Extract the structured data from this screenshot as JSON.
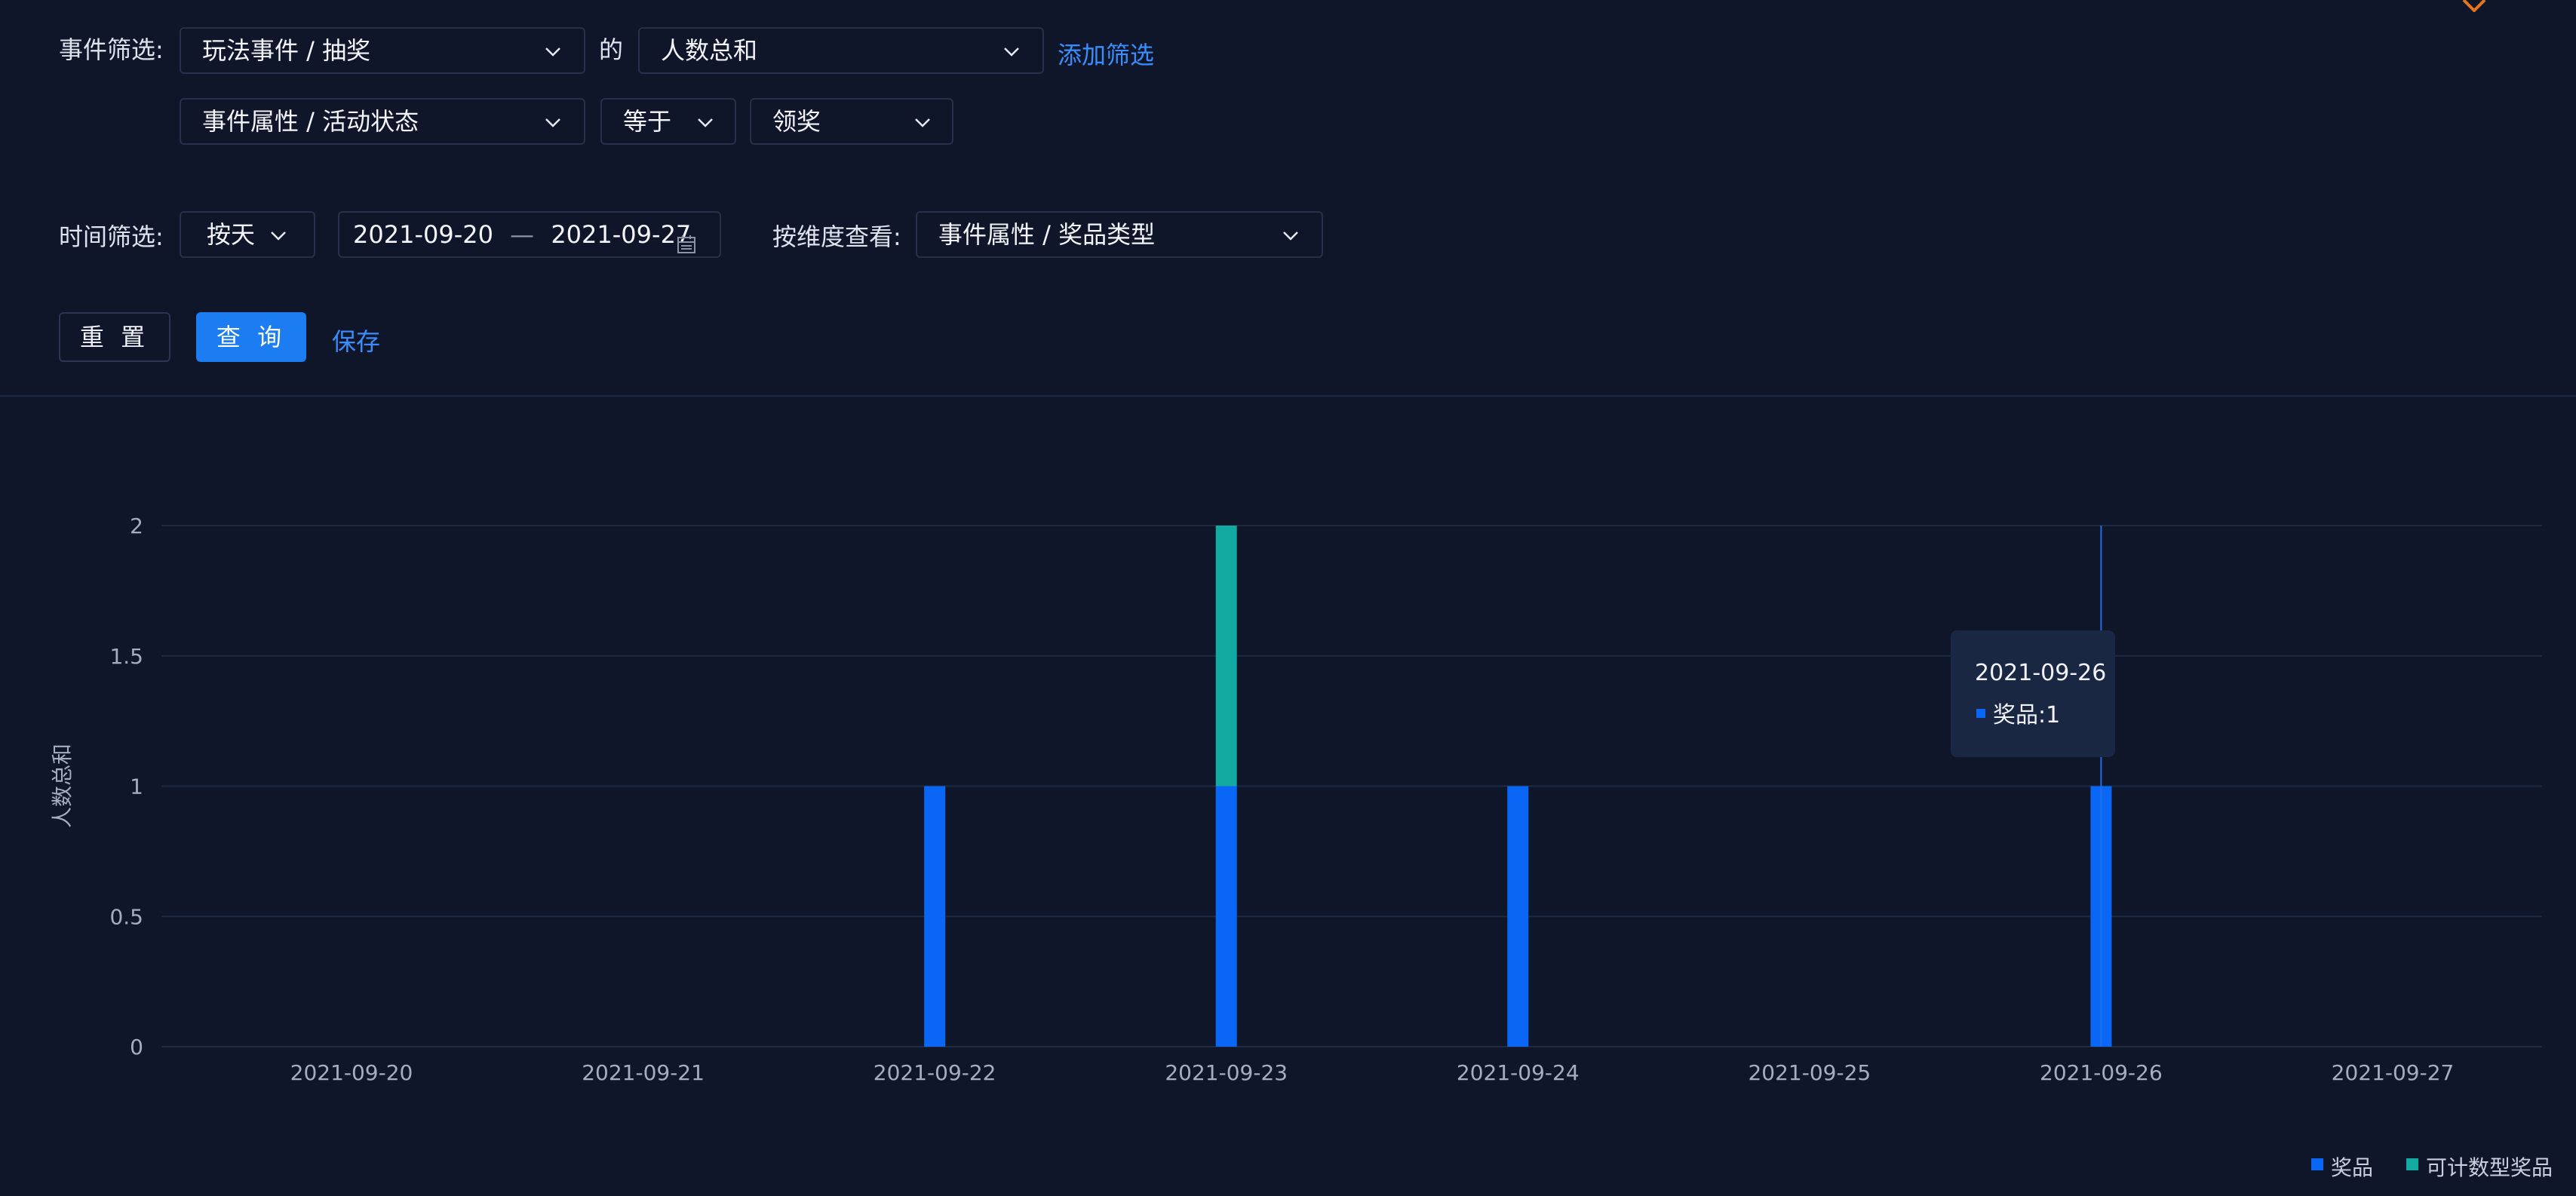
{
  "filters": {
    "event_label": "事件筛选:",
    "event_select": "玩法事件 / 抽奖",
    "of_label": "的",
    "metric_select": "人数总和",
    "add_filter": "添加筛选",
    "prop_select": "事件属性 / 活动状态",
    "operator_select": "等于",
    "value_select": "领奖"
  },
  "time": {
    "label": "时间筛选:",
    "granularity": "按天",
    "start_date": "2021-09-20",
    "separator": "—",
    "end_date": "2021-09-27",
    "dimension_label": "按维度查看:",
    "dimension_select": "事件属性 / 奖品类型"
  },
  "actions": {
    "reset": "重 置",
    "query": "查 询",
    "save": "保存"
  },
  "colors": {
    "accent": "#1c7cf2",
    "series_prize": "#0a67f5",
    "series_countable": "#11a9a0"
  },
  "chart_data": {
    "type": "bar",
    "stacked": true,
    "ylabel": "人数总和",
    "xlabel": "",
    "ylim": [
      0,
      2
    ],
    "yticks": [
      "0",
      "0.5",
      "1",
      "1.5",
      "2"
    ],
    "categories": [
      "2021-09-20",
      "2021-09-21",
      "2021-09-22",
      "2021-09-23",
      "2021-09-24",
      "2021-09-25",
      "2021-09-26",
      "2021-09-27"
    ],
    "series": [
      {
        "name": "奖品",
        "values": [
          0,
          0,
          1,
          1,
          1,
          0,
          1,
          0
        ]
      },
      {
        "name": "可计数型奖品",
        "values": [
          0,
          0,
          0,
          1,
          0,
          0,
          0,
          0
        ]
      }
    ],
    "legend_position": "bottom-right",
    "grid": true,
    "tooltip": {
      "category": "2021-09-26",
      "series_label": "奖品:",
      "value": "1"
    }
  }
}
